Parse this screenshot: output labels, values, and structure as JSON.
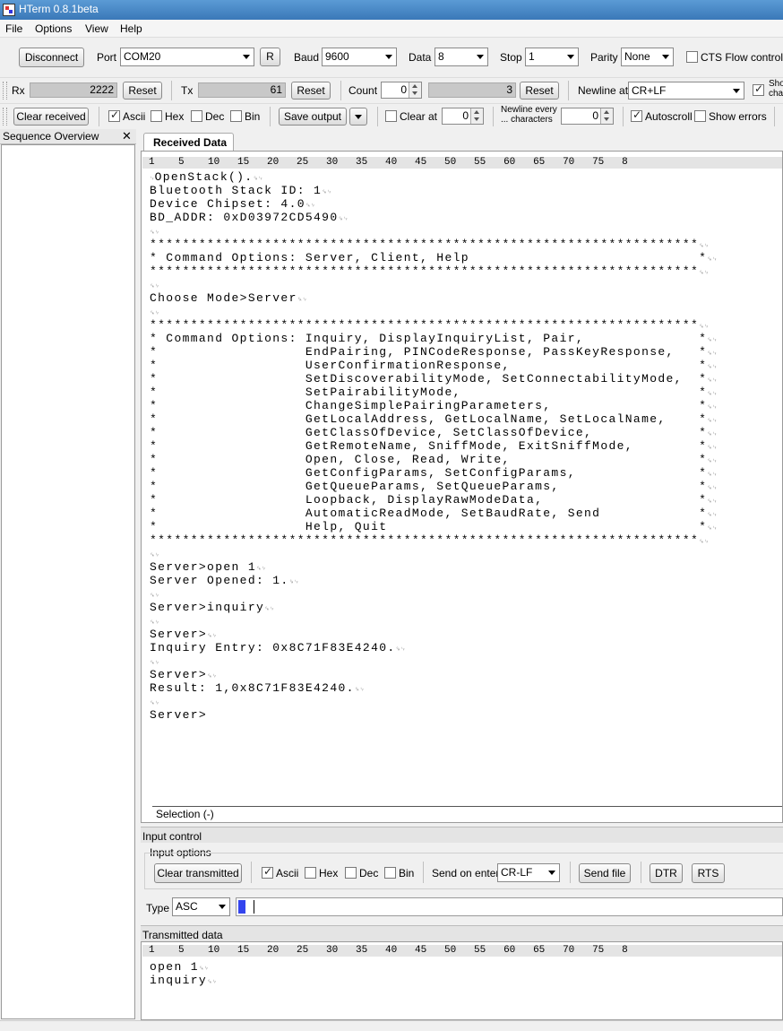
{
  "window": {
    "title": "HTerm 0.8.1beta"
  },
  "menu": [
    "File",
    "Options",
    "View",
    "Help"
  ],
  "toolbar1": {
    "disconnect": "Disconnect",
    "port_label": "Port",
    "port_value": "COM20",
    "r_button": "R",
    "baud_label": "Baud",
    "baud_value": "9600",
    "data_label": "Data",
    "data_value": "8",
    "stop_label": "Stop",
    "stop_value": "1",
    "parity_label": "Parity",
    "parity_value": "None",
    "cts_label": "CTS Flow control",
    "cts_checked": false
  },
  "toolbar2": {
    "rx_label": "Rx",
    "rx_value": "2222",
    "rx_reset": "Reset",
    "tx_label": "Tx",
    "tx_value": "61",
    "tx_reset": "Reset",
    "count_label": "Count",
    "count_value": "0",
    "count_gauge": "3",
    "count_reset": "Reset",
    "newline_label": "Newline at",
    "newline_value": "CR+LF",
    "show_label_1": "Sho",
    "show_label_2": "cha"
  },
  "toolbar3": {
    "clear_received": "Clear received",
    "ascii": "Ascii",
    "hex": "Hex",
    "dec": "Dec",
    "bin": "Bin",
    "save_output": "Save output",
    "clear_at": "Clear at",
    "clear_at_value": "0",
    "newline_every_1": "Newline every",
    "newline_every_2": "... characters",
    "newline_every_value": "0",
    "autoscroll": "Autoscroll",
    "show_errors": "Show errors"
  },
  "sequence": {
    "title": "Sequence Overview",
    "close": "✕"
  },
  "received": {
    "tab": "Received Data",
    "ruler": "1    5    10   15   20   25   30   35   40   45   50   55   60   65   70   75   8",
    "lines": [
      {
        "t": "OpenStack().",
        "nl": true,
        "lead": true
      },
      {
        "t": "Bluetooth Stack ID: 1",
        "nl": true
      },
      {
        "t": "Device Chipset: 4.0",
        "nl": true
      },
      {
        "t": "BD_ADDR: 0xD03972CD5490",
        "nl": true
      },
      {
        "t": "",
        "nl": true
      },
      {
        "t": "*******************************************************************",
        "nl": true
      },
      {
        "t": "* Command Options: Server, Client, Help                            *",
        "nl": true
      },
      {
        "t": "*******************************************************************",
        "nl": true
      },
      {
        "t": "",
        "nl": true
      },
      {
        "t": "Choose Mode>Server",
        "nl": true
      },
      {
        "t": "",
        "nl": true
      },
      {
        "t": "*******************************************************************",
        "nl": true
      },
      {
        "t": "* Command Options: Inquiry, DisplayInquiryList, Pair,              *",
        "nl": true
      },
      {
        "t": "*                  EndPairing, PINCodeResponse, PassKeyResponse,   *",
        "nl": true
      },
      {
        "t": "*                  UserConfirmationResponse,                       *",
        "nl": true
      },
      {
        "t": "*                  SetDiscoverabilityMode, SetConnectabilityMode,  *",
        "nl": true
      },
      {
        "t": "*                  SetPairabilityMode,                             *",
        "nl": true
      },
      {
        "t": "*                  ChangeSimplePairingParameters,                  *",
        "nl": true
      },
      {
        "t": "*                  GetLocalAddress, GetLocalName, SetLocalName,    *",
        "nl": true
      },
      {
        "t": "*                  GetClassOfDevice, SetClassOfDevice,             *",
        "nl": true
      },
      {
        "t": "*                  GetRemoteName, SniffMode, ExitSniffMode,        *",
        "nl": true
      },
      {
        "t": "*                  Open, Close, Read, Write,                       *",
        "nl": true
      },
      {
        "t": "*                  GetConfigParams, SetConfigParams,               *",
        "nl": true
      },
      {
        "t": "*                  GetQueueParams, SetQueueParams,                 *",
        "nl": true
      },
      {
        "t": "*                  Loopback, DisplayRawModeData,                   *",
        "nl": true
      },
      {
        "t": "*                  AutomaticReadMode, SetBaudRate, Send            *",
        "nl": true
      },
      {
        "t": "*                  Help, Quit                                      *",
        "nl": true
      },
      {
        "t": "*******************************************************************",
        "nl": true
      },
      {
        "t": "",
        "nl": true
      },
      {
        "t": "Server>open 1",
        "nl": true
      },
      {
        "t": "Server Opened: 1.",
        "nl": true
      },
      {
        "t": "",
        "nl": true
      },
      {
        "t": "Server>inquiry",
        "nl": true
      },
      {
        "t": "",
        "nl": true
      },
      {
        "t": "Server>",
        "nl": true
      },
      {
        "t": "Inquiry Entry: 0x8C71F83E4240.",
        "nl": true
      },
      {
        "t": "",
        "nl": true
      },
      {
        "t": "Server>",
        "nl": true
      },
      {
        "t": "Result: 1,0x8C71F83E4240.",
        "nl": true
      },
      {
        "t": "",
        "nl": true
      },
      {
        "t": "Server>",
        "nl": false
      }
    ],
    "selection": "Selection (-)"
  },
  "input_control": {
    "title": "Input control",
    "options_title": "Input options",
    "clear_transmitted": "Clear transmitted",
    "ascii": "Ascii",
    "hex": "Hex",
    "dec": "Dec",
    "bin": "Bin",
    "send_on_enter_label": "Send on enter",
    "send_on_enter_value": "CR-LF",
    "send_file": "Send file",
    "dtr": "DTR",
    "rts": "RTS",
    "type_label": "Type",
    "type_value": "ASC"
  },
  "transmitted": {
    "title": "Transmitted data",
    "ruler": "1    5    10   15   20   25   30   35   40   45   50   55   60   65   70   75   8",
    "lines": [
      {
        "t": "open 1",
        "nl": true
      },
      {
        "t": "inquiry",
        "nl": true
      }
    ]
  },
  "newline_glyph": "␍␊"
}
